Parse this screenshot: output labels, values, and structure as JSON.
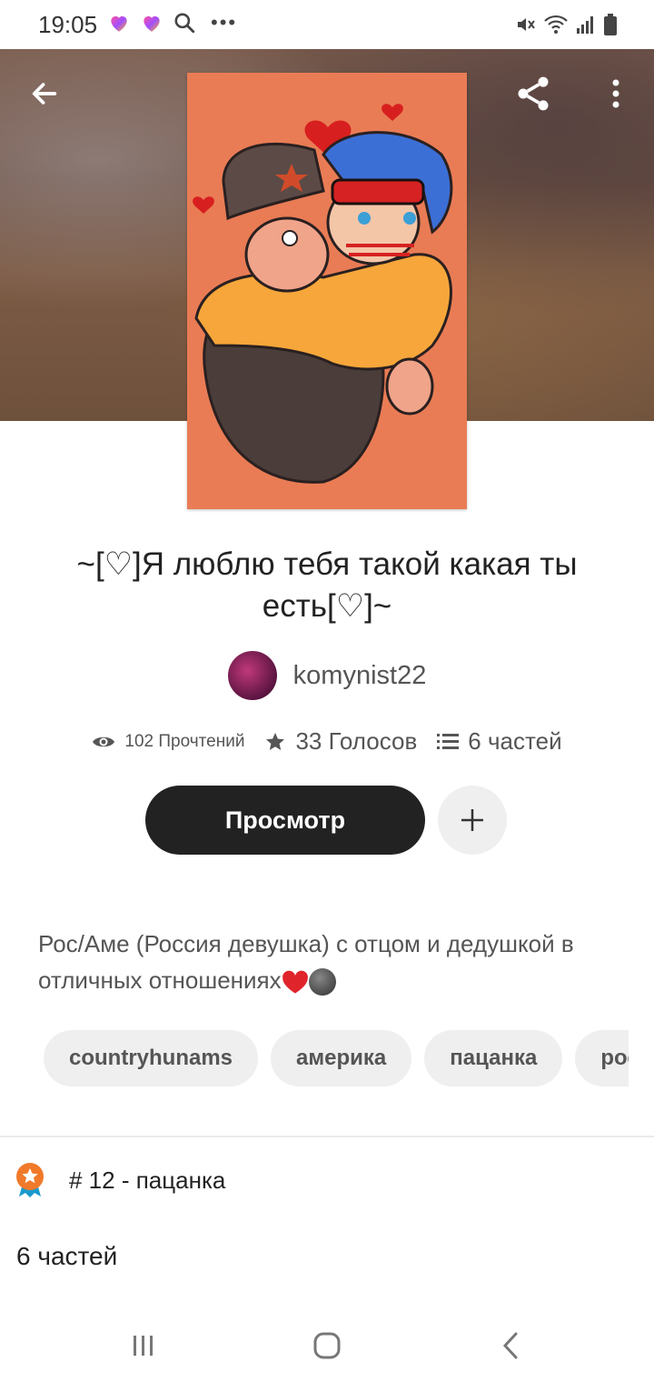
{
  "status_bar": {
    "time": "19:05",
    "icons_left": [
      "heart-app-icon",
      "heart-app-icon",
      "search-icon",
      "more-dots-icon"
    ],
    "icons_right": [
      "mute-icon",
      "wifi-icon",
      "signal-icon",
      "battery-icon"
    ]
  },
  "header": {
    "icons": [
      "back-arrow-icon",
      "share-icon",
      "more-vertical-icon"
    ]
  },
  "story": {
    "title": "~[♡]Я люблю тебя такой какая ты есть[♡]~",
    "author": "komynist22",
    "reads": "102 Прочтений",
    "votes": "33 Голосов",
    "parts": "6 частей",
    "view_button": "Просмотр",
    "description": "Рос/Аме (Россия девушка) с отцом и дедушкой в отличных отношениях",
    "tags": [
      "countryhunams",
      "америка",
      "пацанка",
      "рос"
    ],
    "rank_text": "# 12 - пацанка",
    "parts_section": "6 частей"
  },
  "colors": {
    "cover_bg": "#e97c55",
    "view_button_bg": "#222222",
    "chip_bg": "#efefef",
    "rank_badge": "#f07a2a"
  }
}
